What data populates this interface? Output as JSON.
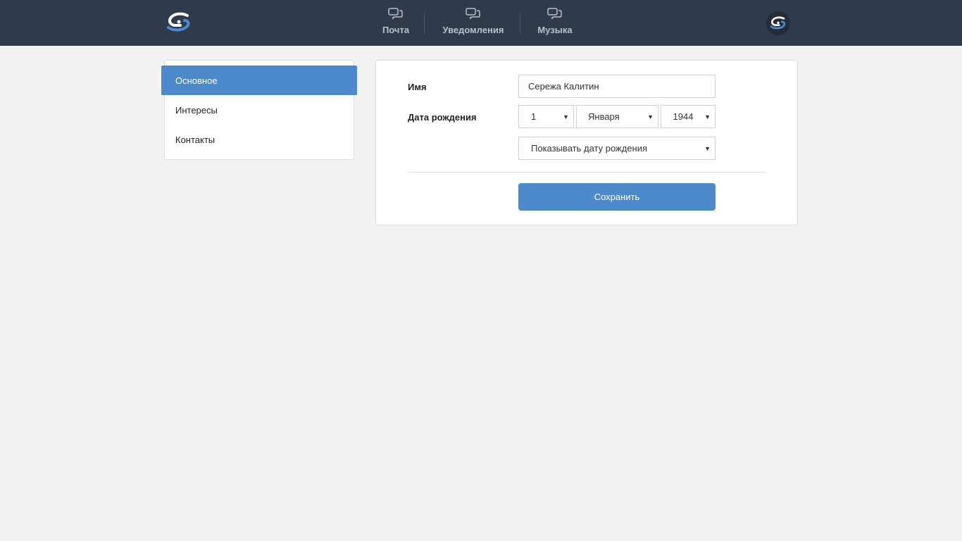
{
  "header": {
    "nav": [
      {
        "label": "Почта",
        "icon": "chat-icon"
      },
      {
        "label": "Уведомления",
        "icon": "chat-icon"
      },
      {
        "label": "Музыка",
        "icon": "chat-icon"
      }
    ]
  },
  "sidebar": {
    "items": [
      {
        "label": "Основное",
        "active": true
      },
      {
        "label": "Интересы",
        "active": false
      },
      {
        "label": "Контакты",
        "active": false
      }
    ]
  },
  "form": {
    "name_label": "Имя",
    "name_value": "Сережа Калитин",
    "birth_label": "Дата рождения",
    "day_value": "1",
    "month_value": "Января",
    "year_value": "1944",
    "visibility_value": "Показывать дату рождения",
    "save_label": "Сохранить"
  },
  "colors": {
    "header_bg": "#2f3a4b",
    "accent": "#4d8acb",
    "page_bg": "#f2f2f2"
  }
}
